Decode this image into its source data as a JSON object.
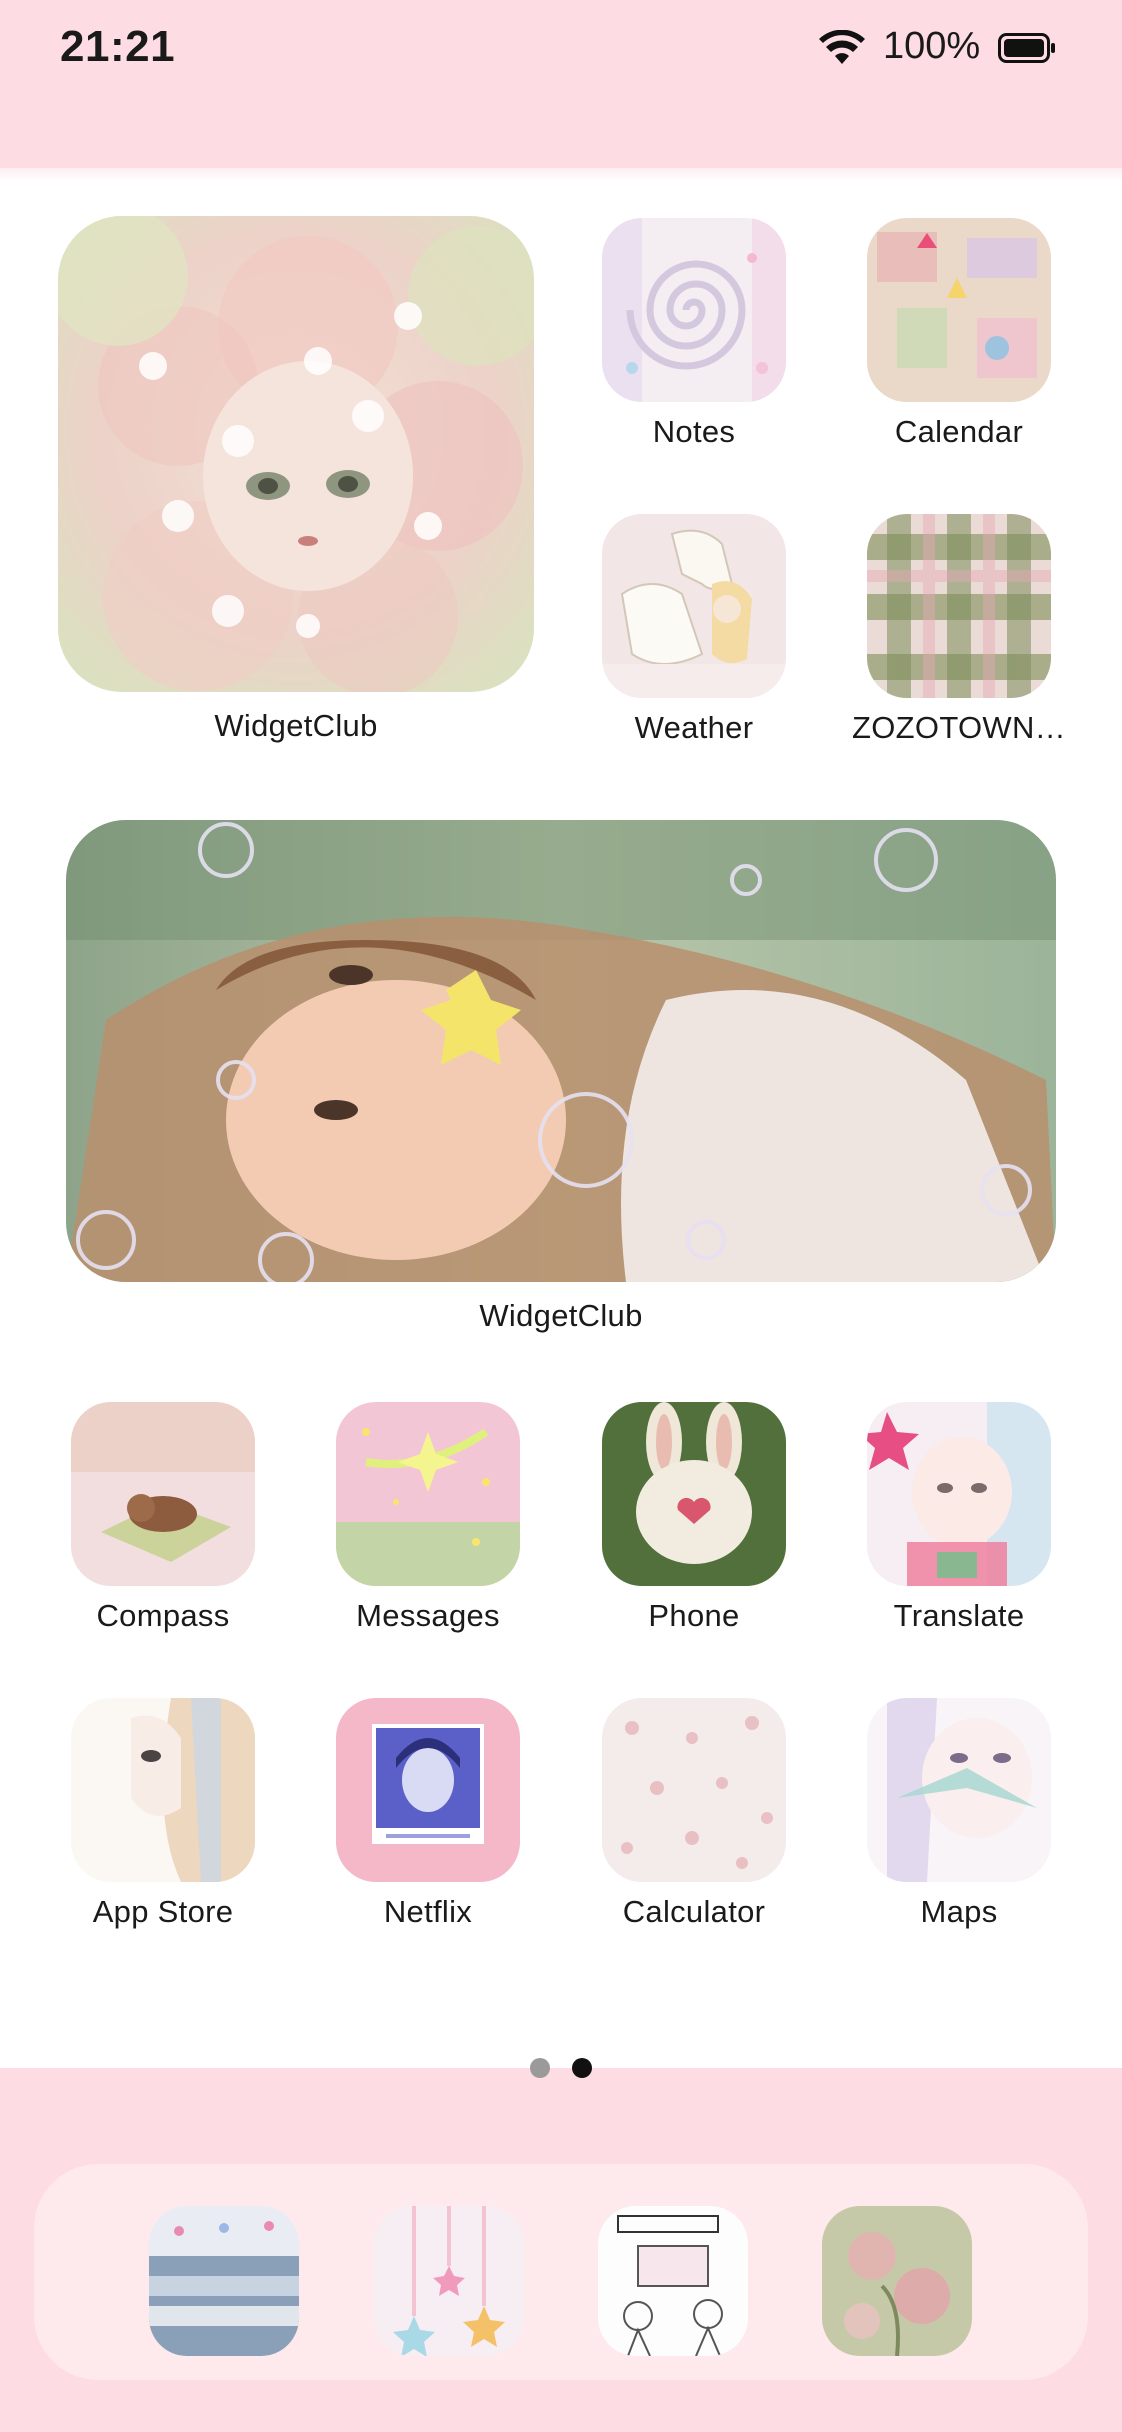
{
  "status_bar": {
    "time": "21:21",
    "battery": "100%"
  },
  "widgets": {
    "top_widget_label": "WidgetClub",
    "wide_widget_label": "WidgetClub"
  },
  "apps": {
    "notes": "Notes",
    "calendar": "Calendar",
    "weather": "Weather",
    "zozotown": "ZOZOTOWN…",
    "compass": "Compass",
    "messages": "Messages",
    "phone": "Phone",
    "translate": "Translate",
    "app_store": "App Store",
    "netflix": "Netflix",
    "calculator": "Calculator",
    "maps": "Maps"
  },
  "icon_art": {
    "notes": "swirl-icon",
    "calendar": "collage-icon",
    "weather": "horse-girl-icon",
    "zozotown": "plaid-icon",
    "compass": "sleeping-dog-icon",
    "messages": "sparkle-icon",
    "phone": "bunny-icon",
    "translate": "girl-star-icon",
    "app_store": "girl-profile-icon",
    "netflix": "photo-girl-icon",
    "calculator": "floral-fabric-icon",
    "maps": "girl-ribbon-icon"
  },
  "pager": {
    "pages": 2,
    "current": 2
  },
  "dock": [
    "ocean-icon",
    "stars-icon",
    "comic-icon",
    "roses-icon"
  ],
  "colors": {
    "band": "#fddde3",
    "accent_pink": "#f4b8c8",
    "text": "#1a1a1a"
  }
}
